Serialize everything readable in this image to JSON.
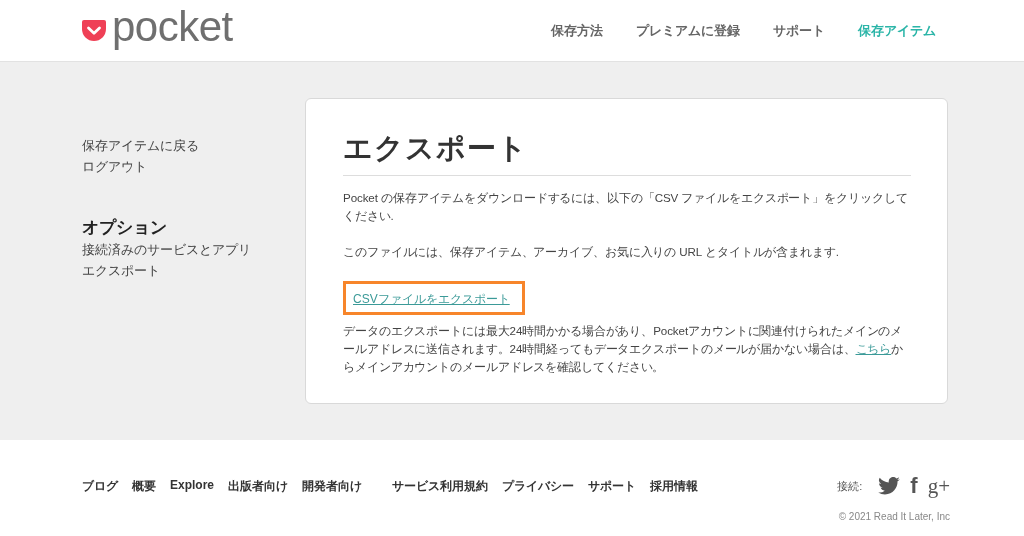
{
  "header": {
    "logo_text": "pocket",
    "nav": [
      {
        "label": "保存方法",
        "selected": false
      },
      {
        "label": "プレミアムに登録",
        "selected": false
      },
      {
        "label": "サポート",
        "selected": false
      },
      {
        "label": "保存アイテム",
        "selected": true
      }
    ]
  },
  "sidebar": {
    "links": [
      "保存アイテムに戻る",
      "ログアウト"
    ],
    "section_title": "オプション",
    "section_links": [
      "接続済みのサービスとアプリ",
      "エクスポート"
    ]
  },
  "main": {
    "title": "エクスポート",
    "paragraphs": [
      "Pocket の保存アイテムをダウンロードするには、以下の「CSV ファイルをエクスポート」をクリックしてください.",
      "このファイルには、保存アイテム、アーカイブ、お気に入りの URL とタイトルが含まれます."
    ],
    "export_link": {
      "label": "CSVファイルをエクスポート",
      "highlighted": true
    },
    "note": {
      "before": "データのエクスポートには最大24時間かかる場合があり、Pocketアカウントに関連付けられたメインのメールアドレスに送信されます。24時間経ってもデータエクスポートのメールが届かない場合は、",
      "link": "こちら",
      "after": "からメインアカウントのメールアドレスを確認してください。"
    }
  },
  "footer": {
    "links": [
      "ブログ",
      "概要",
      "Explore",
      "出版者向け",
      "開発者向け"
    ],
    "links_2": [
      "サービス利用規約",
      "プライバシー",
      "サポート",
      "採用情報"
    ],
    "connect_label": "接続:",
    "social": [
      {
        "kind": "twitter"
      },
      {
        "kind": "facebook",
        "glyph": "f"
      },
      {
        "kind": "google",
        "glyph": "g+"
      }
    ],
    "copyright": "© 2021 Read It Later, Inc"
  }
}
